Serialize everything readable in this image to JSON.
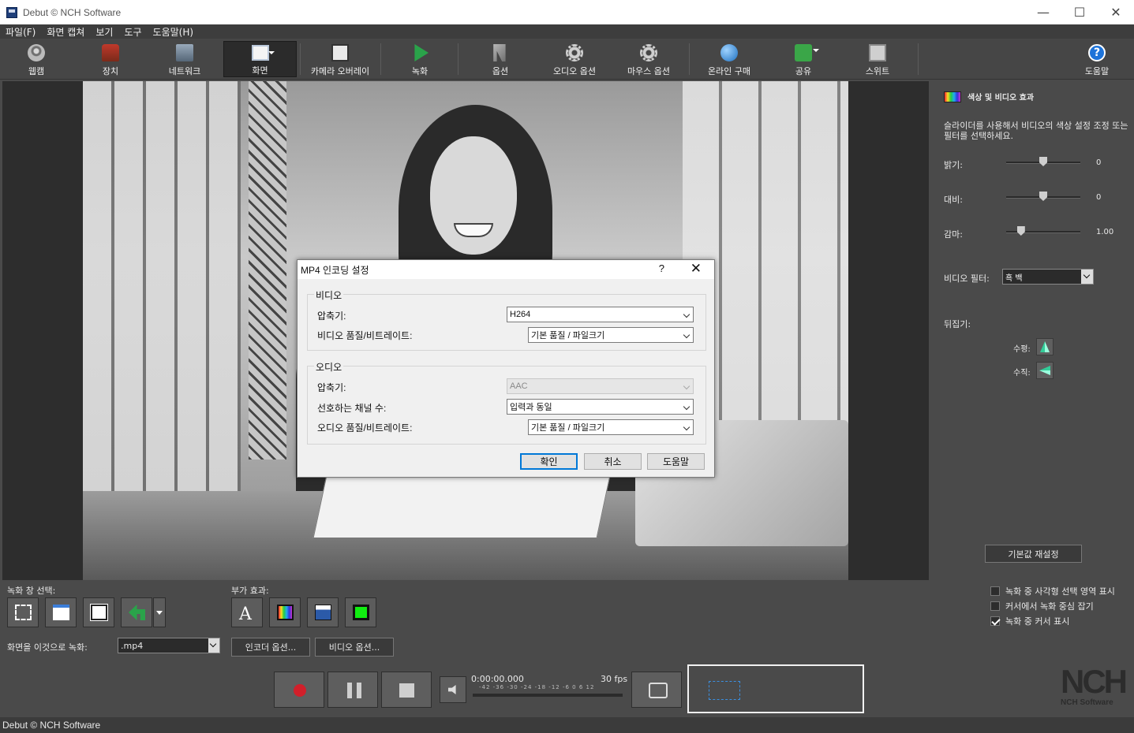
{
  "window": {
    "title": "Debut © NCH Software",
    "minimize": "—",
    "maximize": "☐",
    "close": "✕"
  },
  "menu": [
    "파일(F)",
    "화면 캡쳐",
    "보기",
    "도구",
    "도움말(H)"
  ],
  "toolbar": {
    "webcam": "웹캠",
    "device": "장치",
    "network": "네트워크",
    "screen": "화면",
    "camera_overlay": "카메라 오버레이",
    "record": "녹화",
    "options": "옵션",
    "audio_options": "오디오 옵션",
    "mouse_options": "마우스 옵션",
    "buy_online": "온라인 구매",
    "share": "공유",
    "suite": "스위트",
    "help": "도움말",
    "help_glyph": "?"
  },
  "dialog": {
    "title": "MP4 인코딩 설정",
    "help_glyph": "?",
    "close_glyph": "✕",
    "video": {
      "group_label": "비디오",
      "compressor_label": "압축기:",
      "compressor_value": "H264",
      "quality_label": "비디오 품질/비트레이트:",
      "quality_value": "기본 품질 / 파일크기"
    },
    "audio": {
      "group_label": "오디오",
      "compressor_label": "압축기:",
      "compressor_value": "AAC",
      "channels_label": "선호하는 채널 수:",
      "channels_value": "입력과 동일",
      "quality_label": "오디오 품질/비트레이트:",
      "quality_value": "기본 품질 / 파일크기"
    },
    "ok": "확인",
    "cancel": "취소",
    "help": "도움말"
  },
  "color_panel": {
    "title": "색상 및 비디오 효과",
    "description": "슬라이더를 사용해서 비디오의 색상 설정 조정 또는 필터를 선택하세요.",
    "brightness": {
      "label": "밝기:",
      "value": "0",
      "fraction": 0.5
    },
    "contrast": {
      "label": "대비:",
      "value": "0",
      "fraction": 0.5
    },
    "gamma": {
      "label": "감마:",
      "value": "1.00",
      "fraction": 0.2
    },
    "video_filter_label": "비디오 필터:",
    "video_filter_value": "흑 백",
    "flip_label": "뒤집기:",
    "flip_horizontal": "수평:",
    "flip_vertical": "수직:",
    "reset": "기본값 재설정"
  },
  "bottom": {
    "record_window_label": "녹화 창 선택:",
    "effects_label": "부가 효과:",
    "record_as_label": "화면을 이것으로 녹화:",
    "format_value": ".mp4",
    "encoder_options": "인코더 옵션...",
    "video_options": "비디오 옵션...",
    "checkboxes": [
      {
        "label": "녹화 중 사각형 선택 영역 표시",
        "checked": false
      },
      {
        "label": "커서에서 녹화 중심 잡기",
        "checked": false
      },
      {
        "label": "녹화 중 커서 표시",
        "checked": true
      }
    ],
    "time": "0:00:00.000",
    "fps": "30 fps",
    "meter_scale": "-42 -36 -30 -24 -18 -12 -6 0 6 12",
    "logo": "NCH",
    "logo_sub": "NCH Software"
  },
  "status": "Debut © NCH Software"
}
